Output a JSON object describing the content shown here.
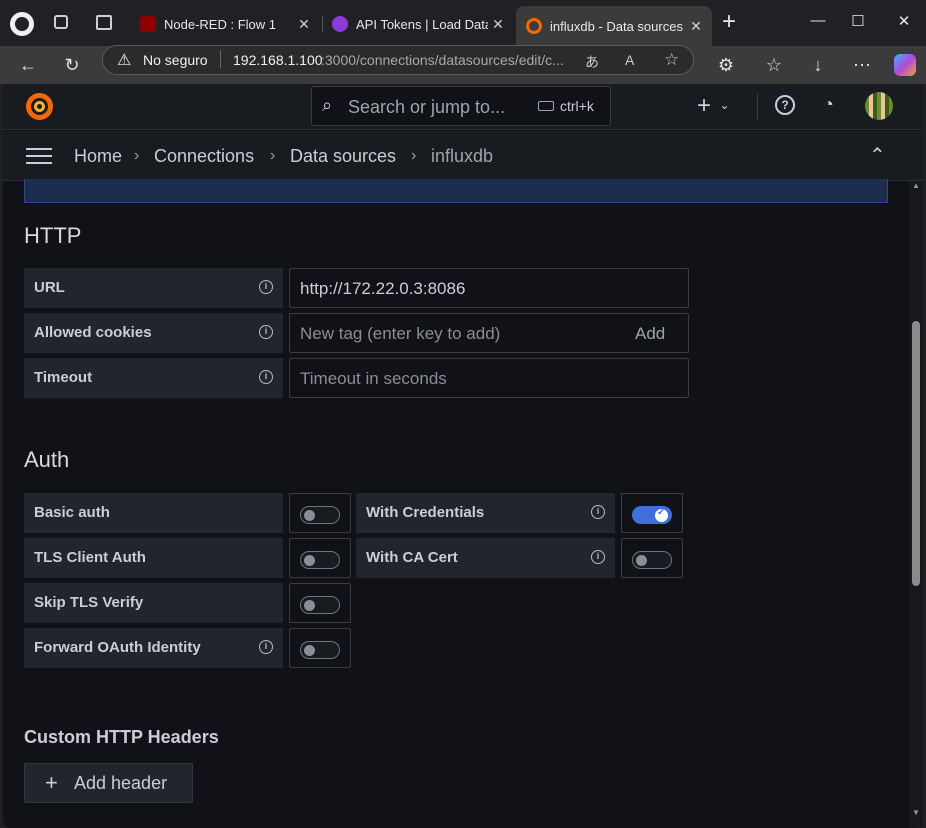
{
  "browser": {
    "tabs": [
      {
        "title": "Node-RED : Flow 1",
        "close": "✕",
        "active": false
      },
      {
        "title": "API Tokens | Load Data | ",
        "close": "✕",
        "active": false
      },
      {
        "title": "influxdb - Data sources - ",
        "close": "✕",
        "active": true
      }
    ],
    "new_tab": "+",
    "security_label": "No seguro",
    "url_host": "192.168.1.100",
    "url_rest": ":3000/connections/datasources/edit/c..."
  },
  "grafana": {
    "search_placeholder": "Search or jump to...",
    "search_shortcut": "ctrl+k",
    "new_label": "+",
    "breadcrumb": [
      "Home",
      "Connections",
      "Data sources",
      "influxdb"
    ],
    "http_section": {
      "title": "HTTP",
      "fields": [
        {
          "label": "URL",
          "value": "http://172.22.0.3:8086",
          "placeholder": ""
        },
        {
          "label": "Allowed cookies",
          "value": "",
          "placeholder": "New tag (enter key to add)",
          "action": "Add"
        },
        {
          "label": "Timeout",
          "value": "",
          "placeholder": "Timeout in seconds"
        }
      ]
    },
    "auth_section": {
      "title": "Auth",
      "basic_auth": {
        "label": "Basic auth",
        "enabled": false
      },
      "with_credentials": {
        "label": "With Credentials",
        "enabled": true
      },
      "tls_client_auth": {
        "label": "TLS Client Auth",
        "enabled": false
      },
      "with_ca_cert": {
        "label": "With CA Cert",
        "enabled": false
      },
      "skip_tls_verify": {
        "label": "Skip TLS Verify",
        "enabled": false
      },
      "forward_oauth": {
        "label": "Forward OAuth Identity",
        "enabled": false
      }
    },
    "headers_section": {
      "title": "Custom HTTP Headers",
      "add_button": "Add header"
    }
  },
  "colors": {
    "accent": "#3d71d9",
    "grafana_orange": "#f46800",
    "bg": "#111217"
  }
}
